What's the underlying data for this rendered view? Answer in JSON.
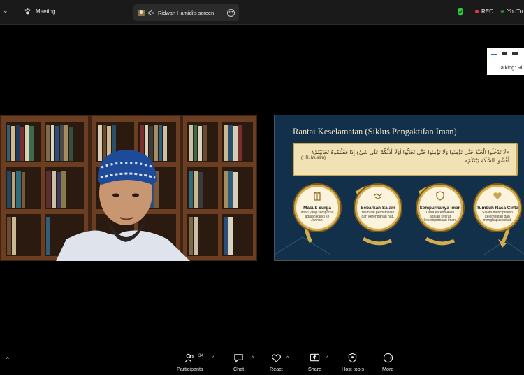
{
  "top_bar": {
    "menu_chevron": "⌄",
    "meeting_label": "Meeting",
    "share_tab_label": "Ridwan Hamidi's screen",
    "rec_label": "REC",
    "youtube_label": "YouTu"
  },
  "view_panel": {
    "talking_label": "Talking: Ri"
  },
  "slide": {
    "title": "Rantai Keselamatan (Siklus Pengaktifan Iman)",
    "hadith_arabic": "«لَا تَدْخُلُوا الْجَنَّةَ حَتَّى تُؤْمِنُوا وَلَا تُؤْمِنُوا حَتَّى تَحَابُّوا أَوَلَا أَدُلُّكُمْ عَلَى شَيْءٍ إِذَا فَعَلْتُمُوهُ تَحَابَبْتُمْ؟ أَفْشُوا السَّلَامَ بَيْنَكُمْ»",
    "hadith_source": "(HR. Muslim)",
    "steps": [
      {
        "label": "Masuk Surga",
        "desc": "Iman yang sempurna adalah kunci ke Jannah.",
        "icon": "gate-icon"
      },
      {
        "label": "Sebarkan Salam",
        "desc": "Memulai perdamaian dan kerendahan hati.",
        "icon": "handshake-icon"
      },
      {
        "label": "Sempurnanya Iman",
        "desc": "Cinta karena Allah adalah syarat kesempurnaan iman.",
        "icon": "shield-icon"
      },
      {
        "label": "Tumbuh Rasa Cinta",
        "desc": "Salam menciptakan kelembutan dan menghapus sekat.",
        "icon": "heart-icon"
      }
    ]
  },
  "bottom_bar": {
    "participants_label": "Participants",
    "participants_count": "34",
    "chat_label": "Chat",
    "react_label": "React",
    "share_label": "Share",
    "host_tools_label": "Host tools",
    "more_label": "More",
    "caret": "^"
  },
  "colors": {
    "accent_gold": "#d4ad4e",
    "rec_red": "#e23b3b",
    "secure_green": "#2ecc40",
    "slide_bg": "#12304a"
  }
}
